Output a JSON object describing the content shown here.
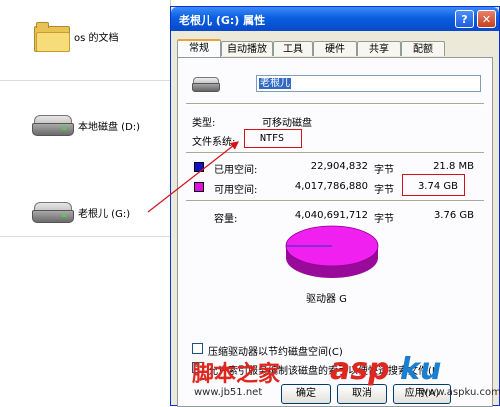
{
  "explorer": {
    "folder_label": "os 的文档",
    "local_disk_label": "本地磁盘 (D:)",
    "removable_label": "老根儿 (G:)"
  },
  "dialog": {
    "title": "老根儿 (G:) 属性",
    "help_glyph": "?",
    "close_glyph": "✕",
    "tabs": [
      "常规",
      "自动播放",
      "工具",
      "硬件",
      "共享",
      "配额"
    ],
    "active_tab": "常规",
    "drive_name": "老根儿",
    "type_label": "类型:",
    "type_value": "可移动磁盘",
    "fs_label": "文件系统:",
    "fs_value": "NTFS",
    "used": {
      "label": "已用空间:",
      "bytes": "22,904,832",
      "unit": "字节",
      "human": "21.8 MB",
      "color": "#1010c8"
    },
    "free": {
      "label": "可用空间:",
      "bytes": "4,017,786,880",
      "unit": "字节",
      "human": "3.74 GB",
      "color": "#e010e0"
    },
    "capacity": {
      "label": "容量:",
      "bytes": "4,040,691,712",
      "unit": "字节",
      "human": "3.76 GB"
    },
    "drive_caption": "驱动器 G",
    "compress_option": "压缩驱动器以节约磁盘空间(C)",
    "index_option": "允许索引服务编制该磁盘的索引以便快速搜索文件(I)",
    "ok_label": "确定",
    "cancel_label": "取消",
    "apply_label": "应用(A)"
  },
  "watermark": {
    "cn": "脚本之家",
    "asp": "asp",
    "ku": "ku",
    "url1": "www.jb51.net",
    "url2": "www.aspku.com"
  }
}
